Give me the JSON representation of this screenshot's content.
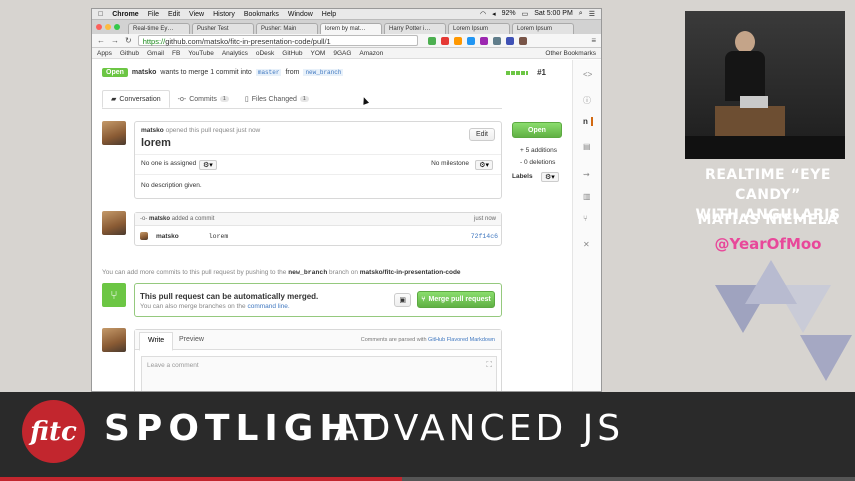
{
  "mac_menu": {
    "apple": "",
    "app": "Chrome",
    "items": [
      "File",
      "Edit",
      "View",
      "History",
      "Bookmarks",
      "Window",
      "Help"
    ],
    "battery": "92%",
    "clock": "Sat 5:00 PM"
  },
  "browser": {
    "tabs": [
      "Real-time Ey…",
      "Pusher Test",
      "Pusher: Main",
      "lorem by mat…",
      "Harry Potter i…",
      "Lorem Ipsum",
      "Lorem Ipsum"
    ],
    "url_scheme": "https://",
    "url_rest": "github.com/matsko/fitc-in-presentation-code/pull/1",
    "bookmarks": [
      "Apps",
      "Github",
      "Gmail",
      "FB",
      "YouTube",
      "Analytics",
      "oDesk",
      "GitHub",
      "YOM",
      "9GAG",
      "Amazon"
    ],
    "other_bookmarks": "Other Bookmarks"
  },
  "pr": {
    "state": "Open",
    "user": "matsko",
    "merge_text": "wants to merge 1 commit into",
    "base_branch": "master",
    "from": "from",
    "head_branch": "new_branch",
    "number": "#1",
    "tabs": [
      {
        "label": "Conversation",
        "icon": "comment-icon"
      },
      {
        "label": "Commits",
        "count": "1",
        "icon": "commit-icon"
      },
      {
        "label": "Files Changed",
        "count": "1",
        "icon": "file-icon"
      }
    ],
    "opened_text": "opened this pull request just now",
    "edit": "Edit",
    "title": "lorem",
    "assignee": "No one is assigned",
    "milestone": "No milestone",
    "description": "No description given.",
    "side_state": "Open",
    "additions": "+ 5 additions",
    "deletions": "- 0 deletions",
    "labels": "Labels",
    "commit_event_user": "matsko",
    "commit_event_text": "added a commit",
    "commit_time": "just now",
    "commit_user": "matsko",
    "commit_msg": "lorem",
    "commit_sha": "72f14c6",
    "more_commits_1": "You can add more commits to this pull request by pushing to the",
    "more_commits_branch": "new_branch",
    "more_commits_2": "branch on",
    "more_commits_repo": "matsko/fitc-in-presentation-code",
    "merge_title": "This pull request can be automatically merged.",
    "merge_sub_1": "You can also merge branches on the",
    "merge_sub_link": "command line.",
    "merge_button": "Merge pull request",
    "write_tab": "Write",
    "preview_tab": "Preview",
    "markdown_note": "Comments are parsed with",
    "markdown_link": "GitHub Flavored Markdown",
    "comment_placeholder": "Leave a comment"
  },
  "talk": {
    "title_line1": "REALTIME “EYE CANDY”",
    "title_line2": "WITH ANGULARJS",
    "speaker": "MATIAS NIEMELÄ",
    "handle": "@YearOfMoo"
  },
  "banner": {
    "logo": "fitc",
    "spotlight": "SPOTLIGHT",
    "advanced": "ADVANCED JS"
  },
  "colors": {
    "accent_pink": "#e8489a",
    "fitc_red": "#c2262e",
    "github_green": "#6cc644"
  },
  "video_progress": 0.47
}
